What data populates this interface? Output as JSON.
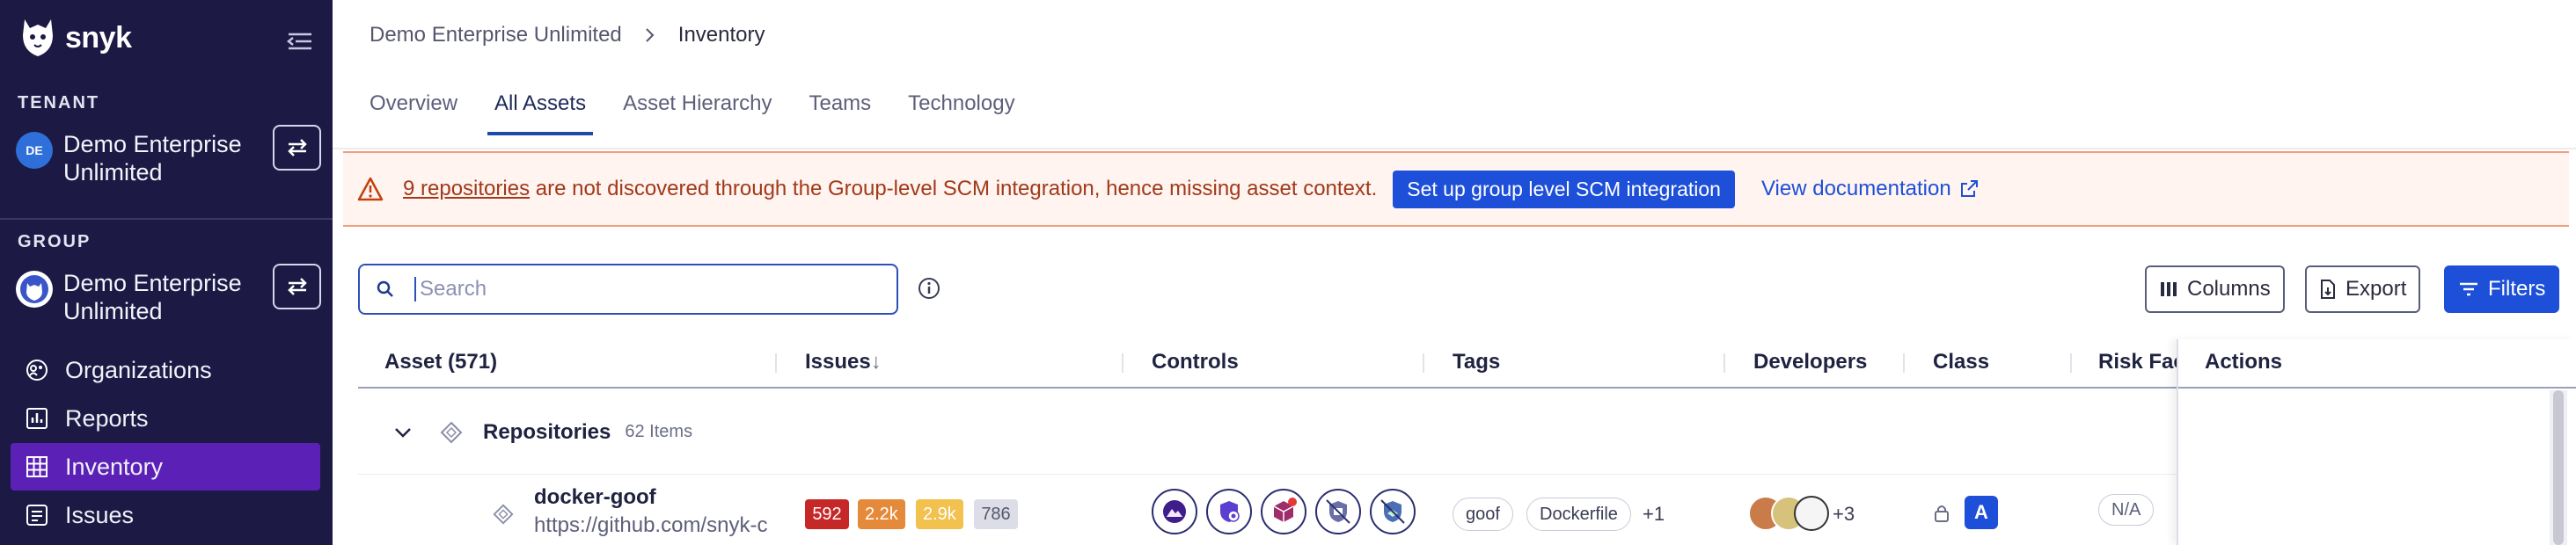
{
  "sidebar": {
    "brand": "snyk",
    "tenant_label": "TENANT",
    "tenant_initials": "DE",
    "tenant_name": "Demo Enterprise Unlimited",
    "group_label": "GROUP",
    "group_name": "Demo Enterprise Unlimited",
    "nav": [
      {
        "label": "Organizations",
        "icon": "organizations-icon"
      },
      {
        "label": "Reports",
        "icon": "reports-icon"
      },
      {
        "label": "Inventory",
        "icon": "inventory-icon",
        "active": true
      },
      {
        "label": "Issues",
        "icon": "issues-icon"
      }
    ]
  },
  "breadcrumb": {
    "parent": "Demo Enterprise Unlimited",
    "current": "Inventory"
  },
  "tabs": [
    {
      "label": "Overview"
    },
    {
      "label": "All Assets",
      "active": true
    },
    {
      "label": "Asset Hierarchy"
    },
    {
      "label": "Teams"
    },
    {
      "label": "Technology"
    }
  ],
  "banner": {
    "link_text": "9 repositories",
    "message": "are not discovered through the Group-level SCM integration, hence missing asset context.",
    "button": "Set up group level SCM integration",
    "doc_link": "View documentation"
  },
  "search": {
    "placeholder": "Search"
  },
  "toolbar": {
    "columns": "Columns",
    "export": "Export",
    "filters": "Filters"
  },
  "table": {
    "headers": {
      "asset": "Asset (571)",
      "issues": "Issues",
      "issues_sort": "↓",
      "controls": "Controls",
      "tags": "Tags",
      "developers": "Developers",
      "class": "Class",
      "risk": "Risk Fac",
      "actions": "Actions"
    },
    "group": {
      "title": "Repositories",
      "count": "62 Items"
    },
    "row": {
      "name": "docker-goof",
      "url": "https://github.com/snyk-c",
      "issues": [
        "592",
        "2.2k",
        "2.9k",
        "786"
      ],
      "tags": [
        "goof",
        "Dockerfile"
      ],
      "tags_more": "+1",
      "developers_more": "+3",
      "class": "A",
      "risk": "N/A"
    }
  },
  "colors": {
    "sidebar_bg": "#1c1a45",
    "nav_active": "#5b21b6",
    "primary": "#1d4fd8",
    "critical": "#c62828",
    "high": "#e58a3a",
    "medium": "#f2c14e",
    "low": "#d9d9e3"
  }
}
